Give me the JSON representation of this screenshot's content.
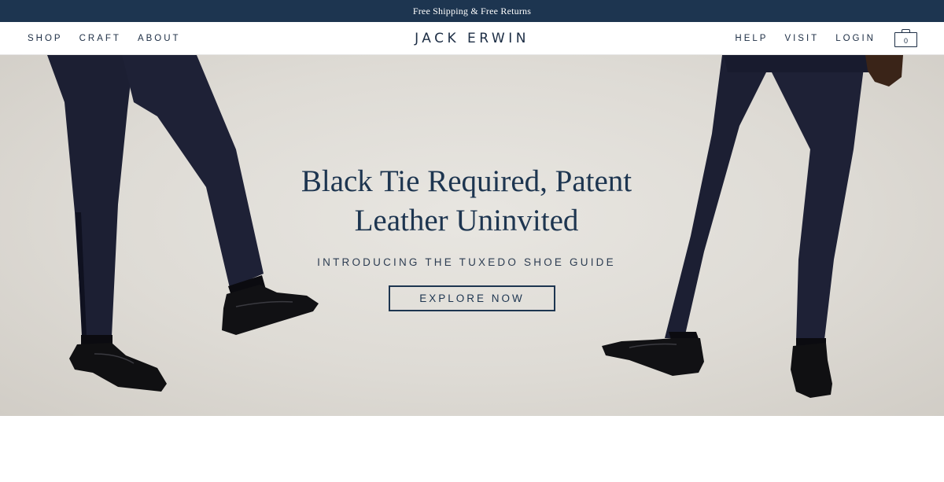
{
  "promo": {
    "text": "Free Shipping & Free Returns"
  },
  "nav": {
    "left": [
      {
        "label": "SHOP"
      },
      {
        "label": "CRAFT"
      },
      {
        "label": "ABOUT"
      }
    ],
    "brand": "JACK ERWIN",
    "right": [
      {
        "label": "HELP"
      },
      {
        "label": "VISIT"
      },
      {
        "label": "LOGIN"
      }
    ],
    "cart_count": "0"
  },
  "hero": {
    "title_line1": "Black Tie Required, Patent",
    "title_line2": "Leather Uninvited",
    "subtitle": "INTRODUCING THE TUXEDO SHOE GUIDE",
    "cta_label": "EXPLORE NOW"
  },
  "colors": {
    "navy": "#1d3550",
    "hero_bg": "#dedbd5",
    "trouser": "#1c1f33"
  }
}
